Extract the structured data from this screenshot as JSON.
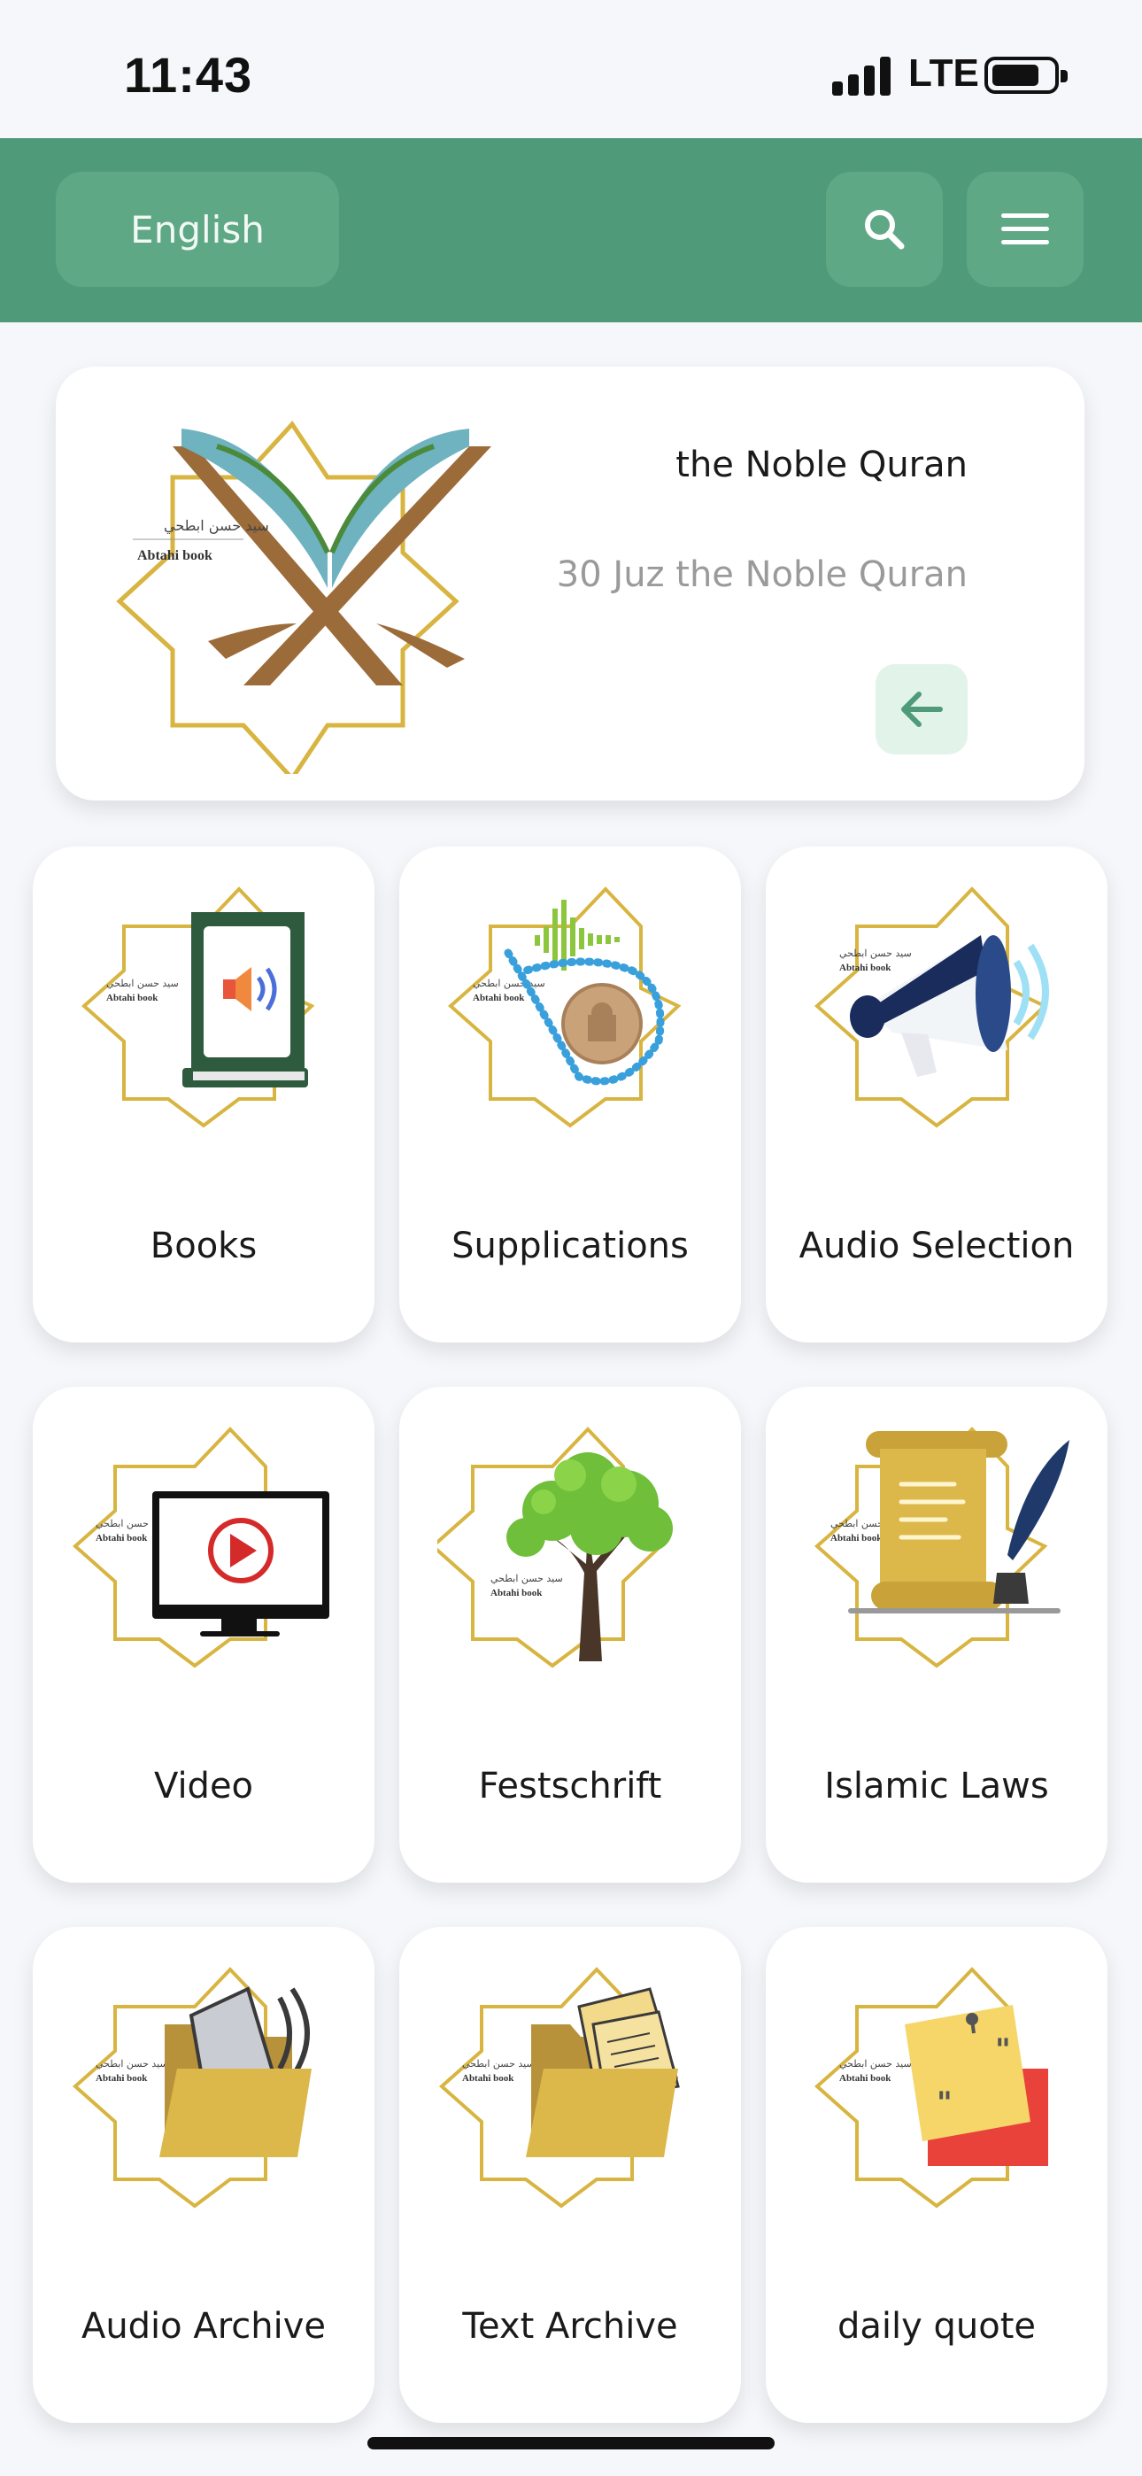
{
  "status_bar": {
    "time": "11:43",
    "network": "LTE",
    "signal_bars": 4,
    "battery_level": 0.75
  },
  "header": {
    "language_label": "English",
    "search_icon": "search-icon",
    "menu_icon": "hamburger-menu-icon",
    "bg_color": "#4f9a79"
  },
  "hero": {
    "title": "the Noble Quran",
    "subtitle": "30 Juz the Noble Quran",
    "logo_arabic": "سيد حسن ابطحي",
    "logo_latin": "Abtahi book",
    "arrow_icon": "arrow-left-icon"
  },
  "tiles": [
    {
      "label": "Books",
      "icon": "audio-book-icon"
    },
    {
      "label": "Supplications",
      "icon": "prayer-beads-icon"
    },
    {
      "label": "Audio Selection",
      "icon": "megaphone-icon"
    },
    {
      "label": "Video",
      "icon": "video-monitor-icon"
    },
    {
      "label": "Festschrift",
      "icon": "tree-icon"
    },
    {
      "label": "Islamic Laws",
      "icon": "scroll-quill-icon"
    },
    {
      "label": "Audio Archive",
      "icon": "audio-folder-icon"
    },
    {
      "label": "Text Archive",
      "icon": "document-folder-icon"
    },
    {
      "label": "daily quote",
      "icon": "sticky-note-quote-icon"
    }
  ],
  "tile_logo": {
    "arabic": "سيد حسن ابطحي",
    "latin": "Abtahi book"
  },
  "colors": {
    "accent": "#4f9a79",
    "gold": "#d8b440",
    "button": "#5fa886"
  }
}
